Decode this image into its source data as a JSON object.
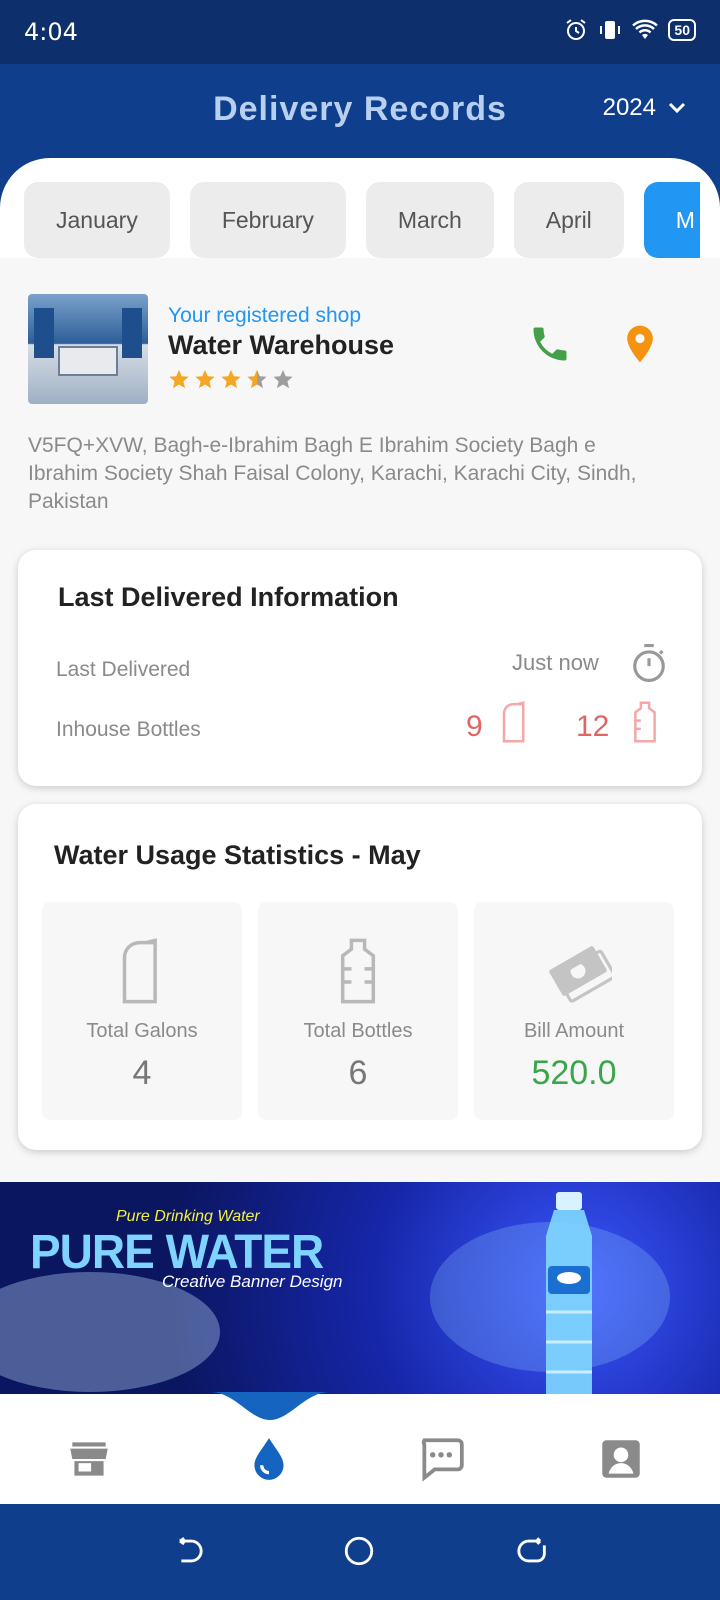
{
  "status_bar": {
    "time": "4:04",
    "battery": "50"
  },
  "header": {
    "title": "Delivery Records",
    "year": "2024"
  },
  "months": [
    "January",
    "February",
    "March",
    "April",
    "M"
  ],
  "active_month_index": 4,
  "shop": {
    "subtitle": "Your registered shop",
    "name": "Water Warehouse",
    "rating": 3.5,
    "max_rating": 5,
    "address": "V5FQ+XVW, Bagh-e-Ibrahim Bagh E Ibrahim Society Bagh e Ibrahim Society Shah Faisal Colony, Karachi, Karachi City, Sindh, Pakistan"
  },
  "last_delivered": {
    "title": "Last Delivered Information",
    "last_label": "Last Delivered",
    "last_value": "Just now",
    "inhouse_label": "Inhouse Bottles",
    "gallons_count": "9",
    "bottles_count": "12"
  },
  "usage": {
    "title": "Water Usage Statistics - May",
    "stats": [
      {
        "label": "Total Galons",
        "value": "4",
        "icon": "gallon-icon"
      },
      {
        "label": "Total Bottles",
        "value": "6",
        "icon": "bottle-icon"
      },
      {
        "label": "Bill Amount",
        "value": "520.0",
        "icon": "money-icon"
      }
    ]
  },
  "banner": {
    "subtitle": "Pure Drinking Water",
    "headline": "PURE WATER",
    "tagline": "Creative Banner Design"
  },
  "bottom_nav": [
    "store-icon",
    "water-drop-icon",
    "chat-icon",
    "profile-icon"
  ],
  "colors": {
    "primary": "#0f3f8c",
    "accent": "#2196f3",
    "green": "#3aa64a",
    "red": "#e26565",
    "orange": "#f5a623"
  }
}
